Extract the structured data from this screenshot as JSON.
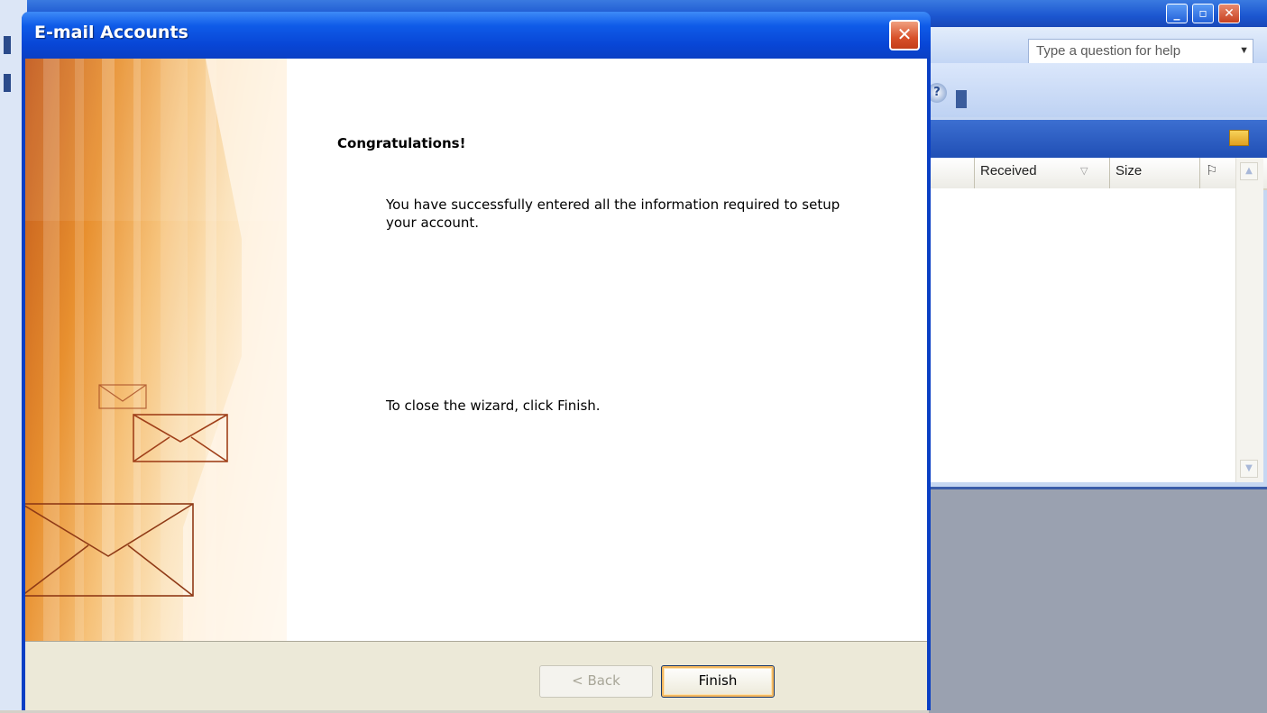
{
  "background_app": {
    "help_box_placeholder": "Type a question for help",
    "columns": [
      {
        "label": "Received"
      },
      {
        "label": "Size"
      }
    ],
    "icons": [
      "minimize-icon",
      "maximize-icon",
      "close-icon",
      "help-icon",
      "inbox-folder-icon"
    ]
  },
  "dialog": {
    "title": "E-mail Accounts",
    "close_symbol": "✕",
    "heading": "Congratulations!",
    "message": "You have successfully entered all the information required to setup your account.",
    "instruction": "To close the wizard, click Finish.",
    "buttons": {
      "back": "< Back",
      "finish": "Finish"
    },
    "back_enabled": false
  },
  "colors": {
    "titlebar": "#0a3fc4",
    "footer": "#ece9d8",
    "art_orange": "#e8902f"
  }
}
